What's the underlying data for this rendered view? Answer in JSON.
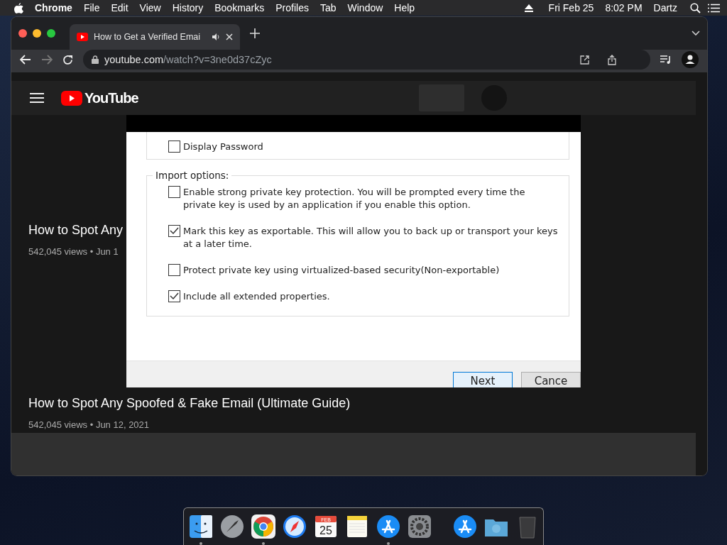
{
  "menubar": {
    "app": "Chrome",
    "menus": [
      "File",
      "Edit",
      "View",
      "History",
      "Bookmarks",
      "Profiles",
      "Tab",
      "Window",
      "Help"
    ],
    "date": "Fri Feb 25",
    "time": "8:02 PM",
    "user": "Dartz"
  },
  "browser": {
    "tab": {
      "title": "How to Get a Verified Emai",
      "audio": true,
      "selected": true
    },
    "url_host": "youtube.com",
    "url_path": "/watch?v=3ne0d37cZyc"
  },
  "youtube": {
    "logo": "YouTube",
    "videos": [
      {
        "title": "How to Spot Any",
        "meta": "542,045 views • Jun 1"
      },
      {
        "title": "How to Spot Any Spoofed & Fake Email (Ultimate Guide)",
        "meta": "542,045 views • Jun 12, 2021"
      }
    ]
  },
  "dialog": {
    "top_options": [
      {
        "label": "Display Password",
        "checked": false
      }
    ],
    "group_title": "Import options:",
    "options": [
      {
        "label": "Enable strong private key protection. You will be prompted every time the private key is used by an application if you enable this option.",
        "checked": false
      },
      {
        "label": "Mark this key as exportable. This will allow you to back up or transport your keys at a later time.",
        "checked": true
      },
      {
        "label": "Protect private key using virtualized-based security(Non-exportable)",
        "checked": false
      },
      {
        "label": "Include all extended properties.",
        "checked": true
      }
    ],
    "buttons": [
      {
        "label": "Next",
        "default": true
      },
      {
        "label": "Cance",
        "default": false
      }
    ]
  },
  "dock": [
    {
      "kind": "finder",
      "running": true
    },
    {
      "kind": "launchpad",
      "running": false
    },
    {
      "kind": "chrome",
      "running": true
    },
    {
      "kind": "safari",
      "running": false
    },
    {
      "kind": "calendar",
      "running": false,
      "month": "FEB",
      "day": "25"
    },
    {
      "kind": "notes",
      "running": false
    },
    {
      "kind": "appstore",
      "running": true
    },
    {
      "kind": "settings",
      "running": false
    },
    {
      "kind": "separator"
    },
    {
      "kind": "appstore",
      "running": false
    },
    {
      "kind": "folder",
      "running": false
    },
    {
      "kind": "trash",
      "running": false
    }
  ]
}
